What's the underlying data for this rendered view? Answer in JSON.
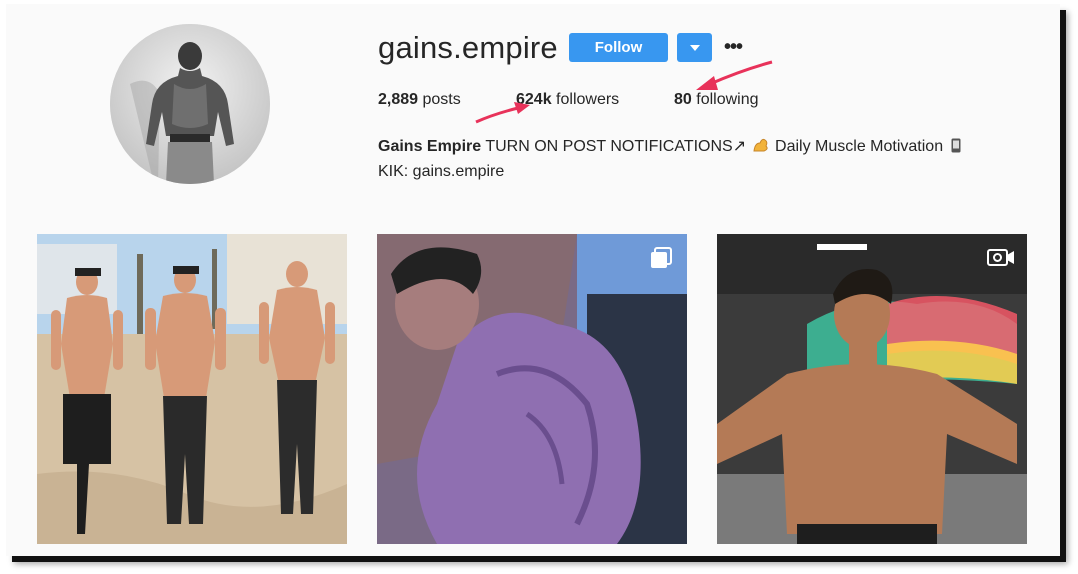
{
  "profile": {
    "username": "gains.empire",
    "follow_label": "Follow",
    "more_label": "•••",
    "stats": {
      "posts_count": "2,889",
      "posts_label": "posts",
      "followers_count": "624k",
      "followers_label": "followers",
      "following_count": "80",
      "following_label": "following"
    },
    "bio": {
      "name": "Gains Empire",
      "text": "TURN ON POST NOTIFICATIONS↗",
      "motivation": "Daily Muscle Motivation",
      "kik": "KIK: gains.empire"
    }
  },
  "colors": {
    "accent": "#3897f0",
    "annotation_arrow": "#e8325a",
    "text": "#262626"
  },
  "icons": {
    "dropdown": "caret-down-icon",
    "flexed_biceps": "flexed-biceps-emoji",
    "phone": "mobile-phone-emoji",
    "carousel": "carousel-icon",
    "video": "video-icon"
  },
  "posts": [
    {
      "type": "photo"
    },
    {
      "type": "carousel"
    },
    {
      "type": "video"
    }
  ]
}
